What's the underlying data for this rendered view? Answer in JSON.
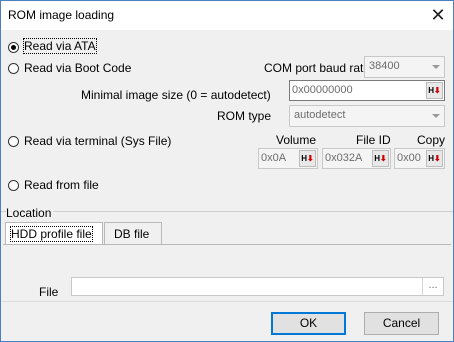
{
  "window": {
    "title": "ROM image loading"
  },
  "options": {
    "read_ata": "Read via ATA",
    "read_boot": "Read via Boot Code",
    "read_terminal": "Read via terminal (Sys File)",
    "read_file": "Read from file"
  },
  "boot": {
    "baud_label": "COM port baud rate",
    "baud_value": "38400",
    "size_label": "Minimal image size (0 = autodetect)",
    "size_value": "0x00000000",
    "romtype_label": "ROM type",
    "romtype_value": "autodetect"
  },
  "terminal": {
    "volume_label": "Volume",
    "volume_value": "0x0A",
    "fileid_label": "File ID",
    "fileid_value": "0x032A",
    "copy_label": "Copy",
    "copy_value": "0x00"
  },
  "location": {
    "label": "Location",
    "tabs": [
      "HDD profile file",
      "DB file"
    ],
    "file_label": "File",
    "file_value": "",
    "browse_label": "..."
  },
  "hex_button": {
    "text": "H",
    "arrow": "⬇"
  },
  "buttons": {
    "ok": "OK",
    "cancel": "Cancel"
  },
  "colors": {
    "accent": "#0078d7",
    "hex_arrow": "#d00000"
  }
}
